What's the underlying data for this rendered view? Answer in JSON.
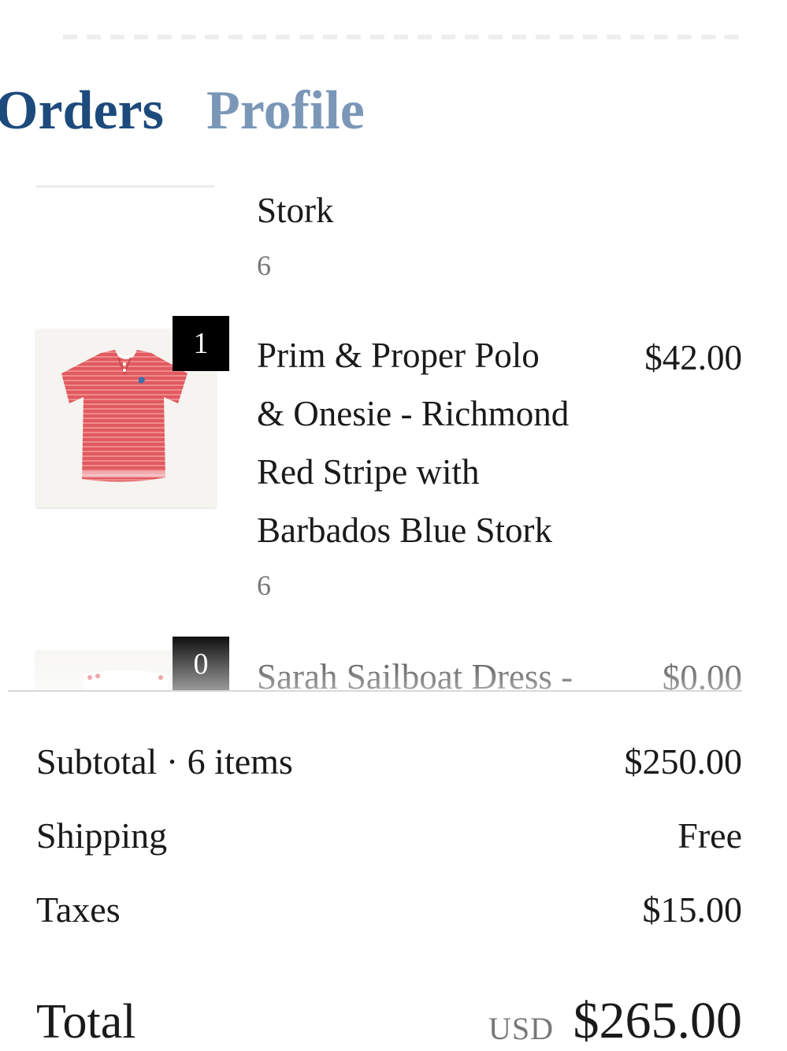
{
  "nav": {
    "tabs": [
      {
        "label": "Orders"
      },
      {
        "label": "Profile"
      }
    ]
  },
  "items": [
    {
      "title_tail": "Stork",
      "variant": "6"
    },
    {
      "quantity": "1",
      "title_lines": [
        "Prim & Proper Polo",
        "& Onesie - Richmond",
        "Red Stripe with",
        "Barbados Blue Stork"
      ],
      "variant": "6",
      "price": "$42.00"
    },
    {
      "quantity": "0",
      "title_lines": [
        "Sarah Sailboat Dress -"
      ],
      "price": "$0.00"
    }
  ],
  "summary": {
    "subtotal_label": "Subtotal · 6 items",
    "subtotal_value": "$250.00",
    "shipping_label": "Shipping",
    "shipping_value": "Free",
    "taxes_label": "Taxes",
    "taxes_value": "$15.00",
    "total_label": "Total",
    "total_currency": "USD",
    "total_value": "$265.00"
  },
  "colors": {
    "nav_active": "#1d4a7c",
    "nav_inactive": "#7b97b8",
    "polo_red": "#e05a5f"
  }
}
